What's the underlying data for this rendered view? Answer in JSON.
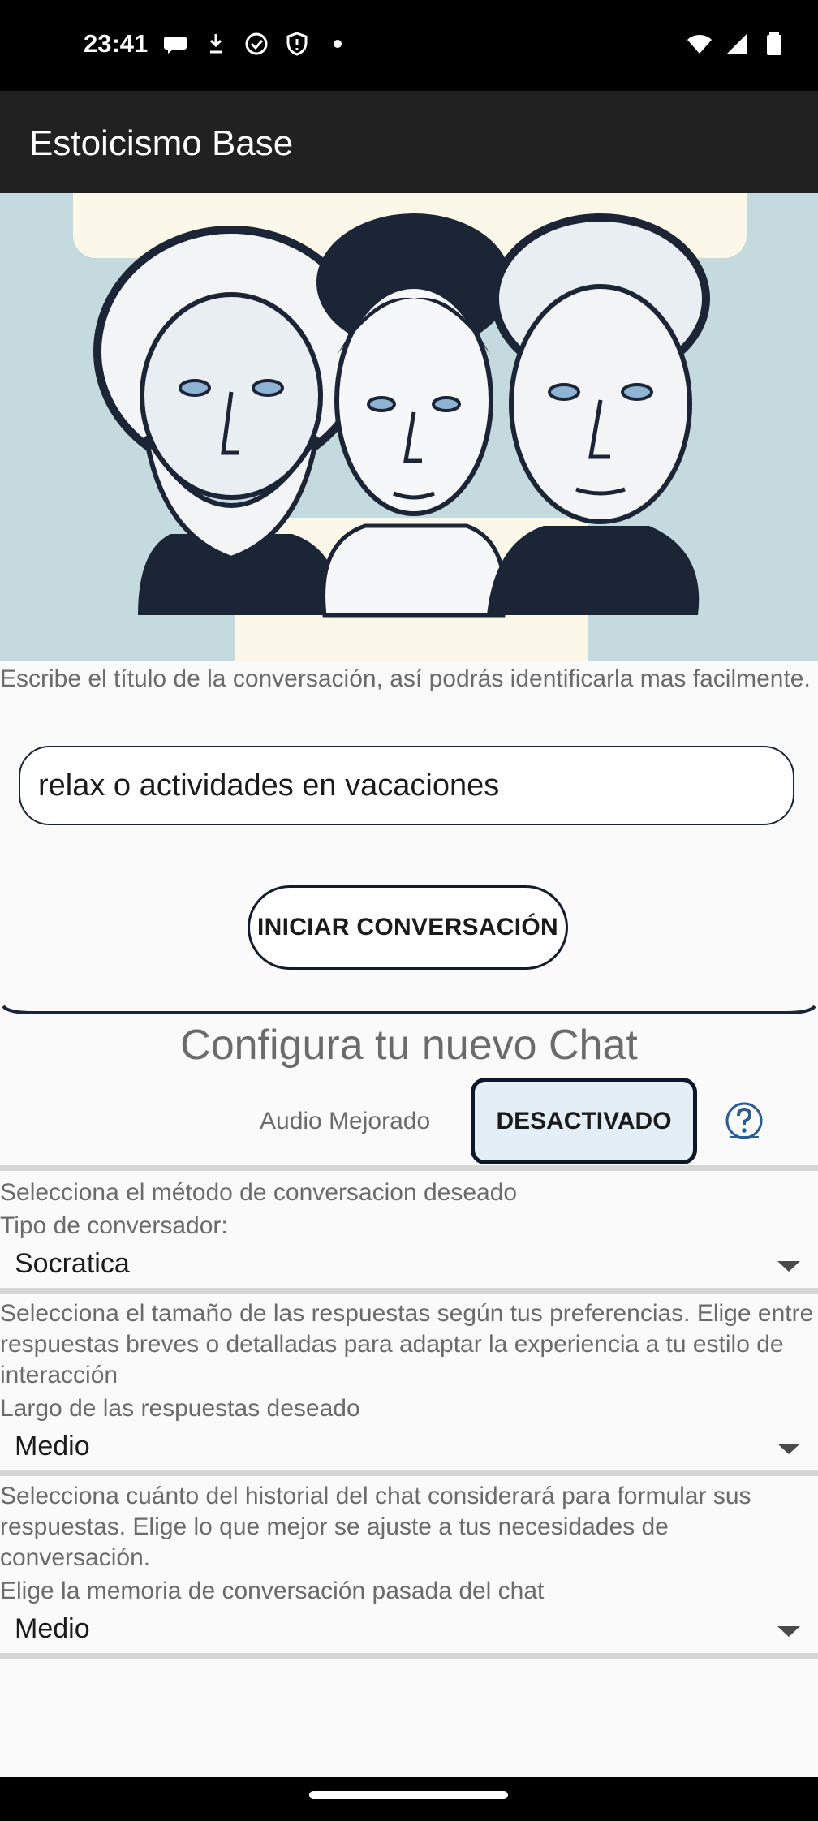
{
  "status_bar": {
    "time": "23:41",
    "icons_left": [
      "chat-bubble-icon",
      "download-icon",
      "check-circle-icon",
      "shield-icon",
      "dot-icon"
    ],
    "icons_right": [
      "wifi-icon",
      "cell-signal-icon",
      "battery-icon"
    ]
  },
  "app_bar": {
    "title": "Estoicismo Base"
  },
  "hero": {
    "image": "three-stoic-philosopher-busts-illustration"
  },
  "title_section": {
    "hint": "Escribe el título de la conversación, así podrás identificarla mas facilmente.",
    "input_value": "relax o actividades en vacaciones"
  },
  "start_button": {
    "label": "INICIAR CONVERSACIÓN"
  },
  "config": {
    "title": "Configura tu nuevo Chat",
    "audio_label": "Audio Mejorado",
    "audio_button": "DESACTIVADO",
    "help_icon": "question-circle-icon"
  },
  "method": {
    "hint": "Selecciona el método de conversacion deseado",
    "label": "Tipo de conversador:",
    "value": "Socratica"
  },
  "length": {
    "hint": "Selecciona el tamaño de las respuestas según tus preferencias. Elige entre respuestas breves o detalladas para adaptar la experiencia a tu estilo de interacción",
    "label": "Largo de las respuestas deseado",
    "value": "Medio"
  },
  "memory": {
    "hint": "Selecciona cuánto del historial del chat considerará para formular sus respuestas. Elige lo que mejor se ajuste a tus necesidades de conversación.",
    "label": "Elige la memoria de conversación pasada del chat",
    "value": "Medio"
  },
  "colors": {
    "app_bar": "#212121",
    "hero_bg": "#c5dade",
    "button_border": "#141c2a",
    "audio_button_bg": "#e3eef6"
  }
}
